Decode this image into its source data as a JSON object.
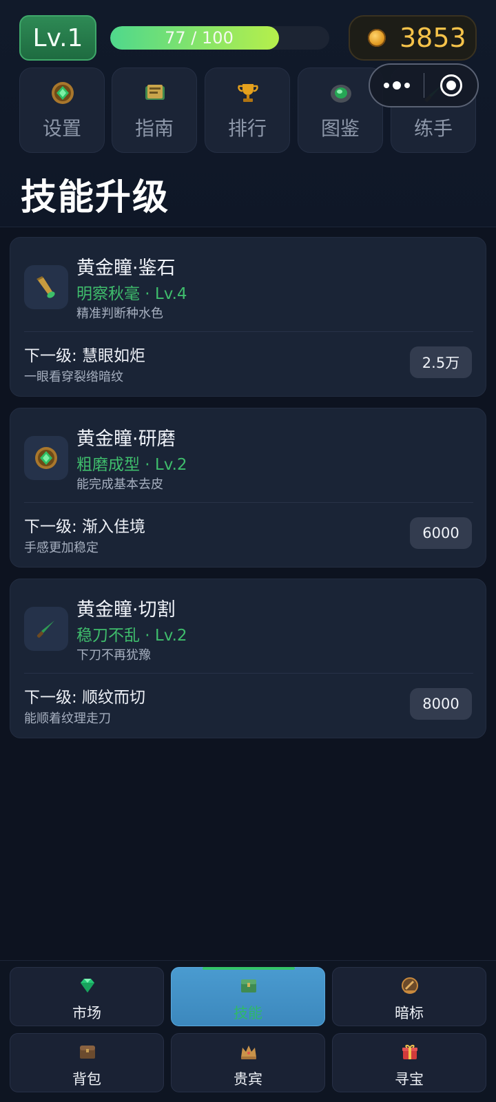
{
  "header": {
    "level_label": "Lv.1",
    "xp_text": "77 / 100",
    "xp_fraction": 0.77,
    "coins": "3853"
  },
  "menu": [
    {
      "label": "设置",
      "icon": "jade-medallion-icon"
    },
    {
      "label": "指南",
      "icon": "book-icon"
    },
    {
      "label": "排行",
      "icon": "trophy-icon"
    },
    {
      "label": "图鉴",
      "icon": "jade-stone-icon"
    },
    {
      "label": "练手",
      "icon": "knife-icon"
    }
  ],
  "page_title": "技能升级",
  "skills": [
    {
      "name": "黄金瞳·鉴石",
      "level": "明察秋毫 · Lv.4",
      "desc": "精准判断种水色",
      "next": "下一级: 慧眼如炬",
      "next_desc": "一眼看穿裂绺暗纹",
      "cost": "2.5万",
      "icon": "flashlight-icon"
    },
    {
      "name": "黄金瞳·研磨",
      "level": "粗磨成型 · Lv.2",
      "desc": "能完成基本去皮",
      "next": "下一级: 渐入佳境",
      "next_desc": "手感更加稳定",
      "cost": "6000",
      "icon": "jade-medallion-icon"
    },
    {
      "name": "黄金瞳·切割",
      "level": "稳刀不乱 · Lv.2",
      "desc": "下刀不再犹豫",
      "next": "下一级: 顺纹而切",
      "next_desc": "能顺着纹理走刀",
      "cost": "8000",
      "icon": "knife-icon"
    }
  ],
  "nav": [
    {
      "label": "市场",
      "icon": "gem-icon",
      "active": false
    },
    {
      "label": "技能",
      "icon": "skill-chest-icon",
      "active": true
    },
    {
      "label": "暗标",
      "icon": "bid-icon",
      "active": false
    },
    {
      "label": "背包",
      "icon": "backpack-chest-icon",
      "active": false
    },
    {
      "label": "贵宾",
      "icon": "crown-icon",
      "active": false
    },
    {
      "label": "寻宝",
      "icon": "gift-icon",
      "active": false
    }
  ],
  "colors": {
    "background": "#0d1320",
    "card": "#1a2436",
    "level_green": "#3fbd6c",
    "coin_gold": "#f6c34a",
    "active_tab": "#4a9bd0"
  }
}
